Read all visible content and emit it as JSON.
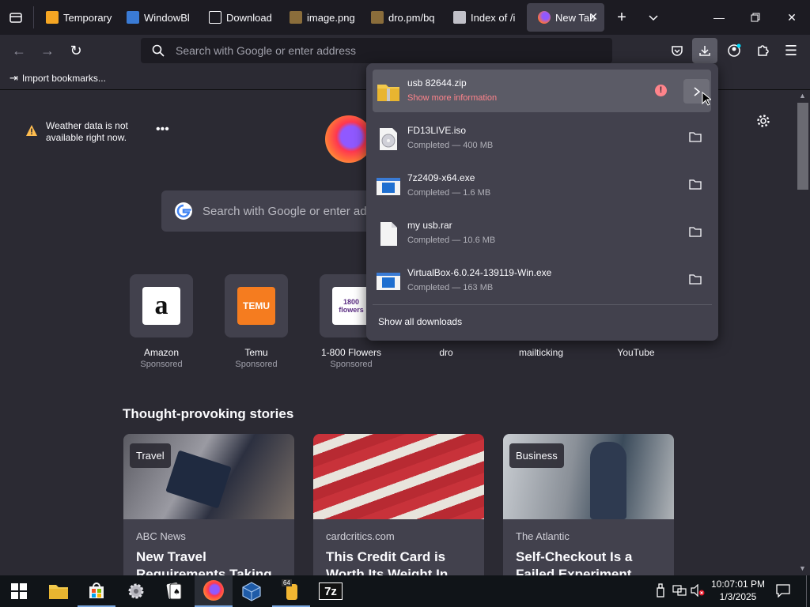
{
  "tabs": [
    {
      "title": "Temporary",
      "icon": "mail-icon"
    },
    {
      "title": "WindowBl",
      "icon": "windowblinds-icon"
    },
    {
      "title": "Download",
      "icon": "download-site-icon"
    },
    {
      "title": "image.png",
      "icon": "image-icon"
    },
    {
      "title": "dro.pm/bq",
      "icon": "page-icon"
    },
    {
      "title": "Index of /i",
      "icon": "index-icon"
    },
    {
      "title": "New Tab",
      "icon": "firefox-icon",
      "active": true
    }
  ],
  "urlbar": {
    "placeholder": "Search with Google or enter address"
  },
  "bookmarks": {
    "import_label": "Import bookmarks..."
  },
  "weather": {
    "message": "Weather data is not available right now."
  },
  "search": {
    "placeholder": "Search with Google or enter ad"
  },
  "shortcuts": [
    {
      "name": "Amazon",
      "sponsored": "Sponsored",
      "logo_text": "a",
      "color": "#ffffff"
    },
    {
      "name": "Temu",
      "sponsored": "Sponsored",
      "logo_text": "TEMU",
      "color": "#f57c1f"
    },
    {
      "name": "1-800 Flowers",
      "sponsored": "Sponsored",
      "logo_text": "1800 flowers",
      "color": "#ffffff"
    },
    {
      "name": "dro",
      "sponsored": ""
    },
    {
      "name": "mailticking",
      "sponsored": ""
    },
    {
      "name": "YouTube",
      "sponsored": ""
    }
  ],
  "stories": {
    "title": "Thought-provoking stories",
    "cards": [
      {
        "badge": "Travel",
        "source": "ABC News",
        "headline": "New Travel Requirements Taking"
      },
      {
        "badge": "",
        "source": "cardcritics.com",
        "headline": "This Credit Card is Worth Its Weight In"
      },
      {
        "badge": "Business",
        "source": "The Atlantic",
        "headline": "Self-Checkout Is a Failed Experiment"
      }
    ]
  },
  "downloads": {
    "items": [
      {
        "name": "usb 82644.zip",
        "status": "Show more information",
        "warning": true,
        "icon": "zip-folder-icon"
      },
      {
        "name": "FD13LIVE.iso",
        "status": "Completed — 400 MB",
        "icon": "disc-image-icon"
      },
      {
        "name": "7z2409-x64.exe",
        "status": "Completed — 1.6 MB",
        "icon": "exe-icon"
      },
      {
        "name": "my usb.rar",
        "status": "Completed — 10.6 MB",
        "icon": "file-icon"
      },
      {
        "name": "VirtualBox-6.0.24-139119-Win.exe",
        "status": "Completed — 163 MB",
        "icon": "exe-icon"
      }
    ],
    "show_all": "Show all downloads"
  },
  "taskbar": {
    "time": "10:07:01 PM",
    "date": "1/3/2025"
  },
  "colors": {
    "accent": "#0df",
    "firefox_orange": "#ff7139",
    "warning": "#ff848b"
  }
}
